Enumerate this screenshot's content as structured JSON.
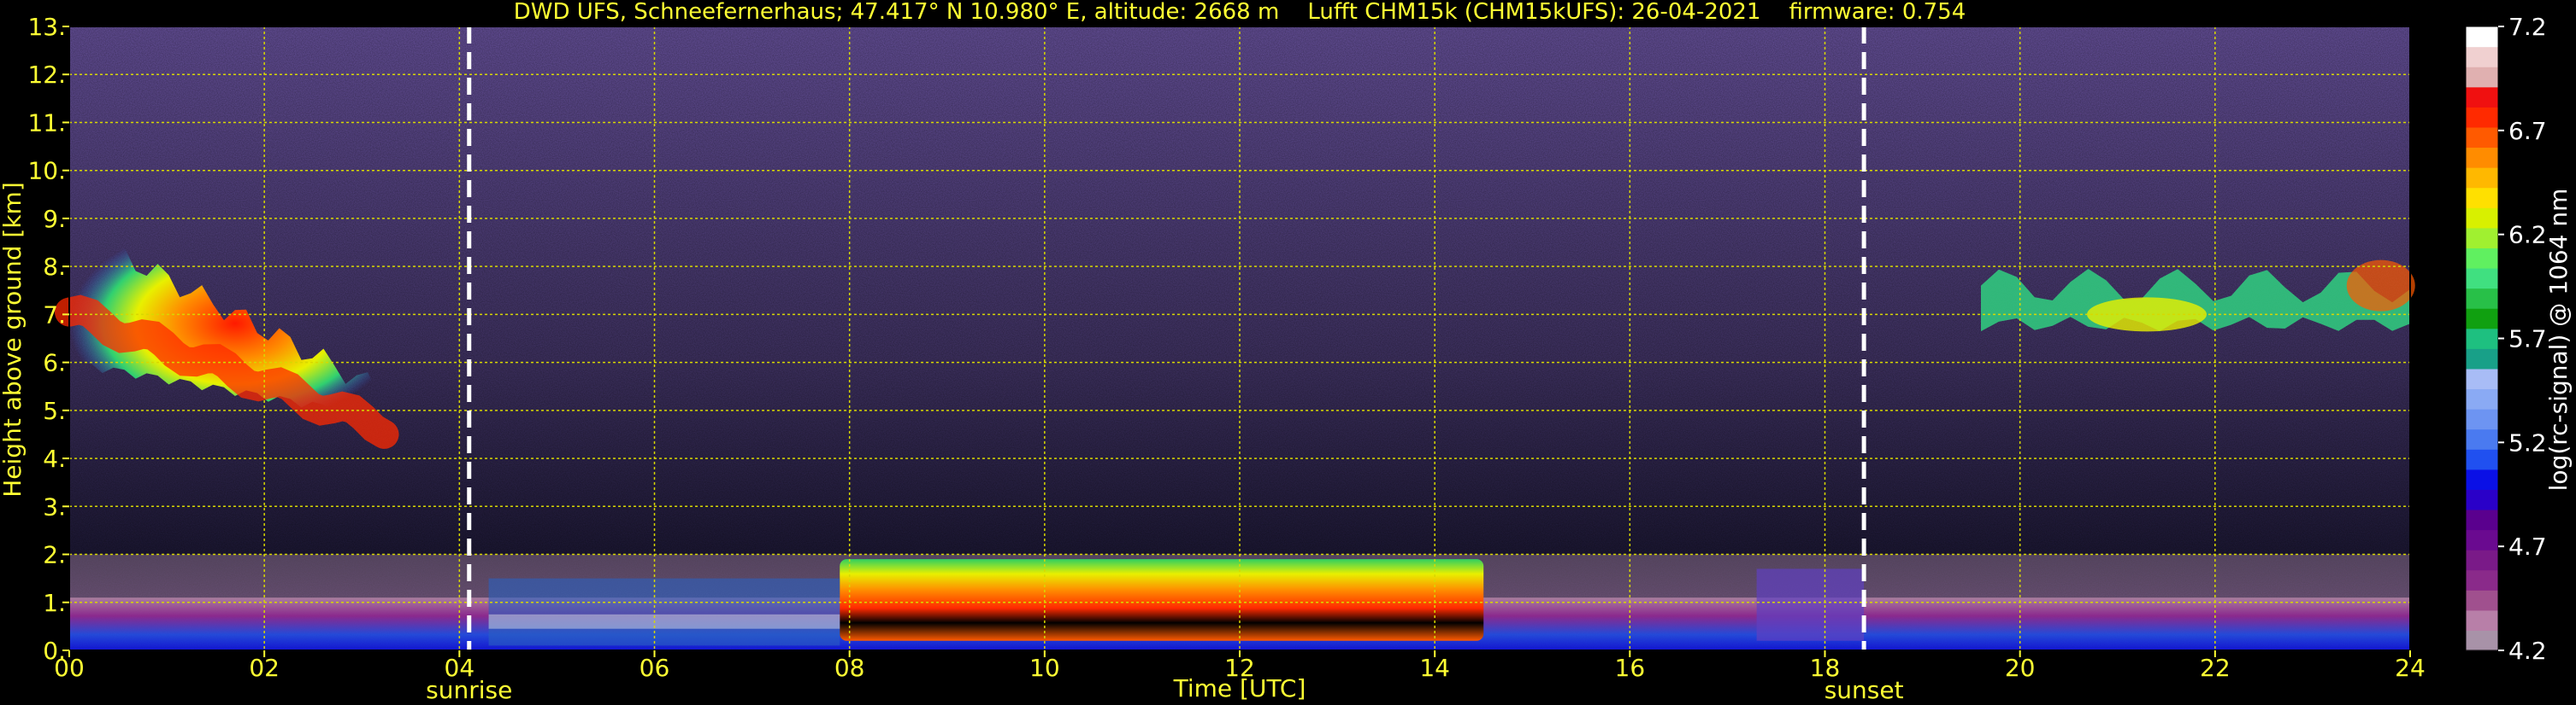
{
  "chart_data": {
    "type": "heatmap",
    "title": "DWD UFS, Schneefernerhaus; 47.417° N 10.980° E, altitude: 2668 m    Lufft CHM15k (CHM15kUFS): 26-04-2021    firmware: 0.754",
    "xlabel": "Time [UTC]",
    "ylabel": "Height above ground [km]",
    "xlim": [
      0,
      24
    ],
    "ylim": [
      0,
      13
    ],
    "x_ticks": [
      "00",
      "02",
      "04",
      "06",
      "08",
      "10",
      "12",
      "14",
      "16",
      "18",
      "20",
      "22",
      "24"
    ],
    "y_ticks": [
      "0.",
      "1.",
      "2.",
      "3.",
      "4.",
      "5.",
      "6.",
      "7.",
      "8.",
      "9.",
      "10.",
      "11.",
      "12.",
      "13."
    ],
    "grid": true,
    "annotations": [
      {
        "label": "sunrise",
        "x": 4.1
      },
      {
        "label": "sunset",
        "x": 18.4
      }
    ],
    "colorbar": {
      "label": "log(rc-signal) @ 1064 nm",
      "range": [
        4.2,
        7.2
      ],
      "ticks": [
        "4.2",
        "4.7",
        "5.2",
        "5.7",
        "6.2",
        "6.7",
        "7.2"
      ],
      "colors": [
        "#a892a8",
        "#b87fa8",
        "#a0508e",
        "#8a2a8a",
        "#7a1a88",
        "#6a0a90",
        "#5a008e",
        "#2a00c8",
        "#0a10e6",
        "#2050f0",
        "#4a7af0",
        "#6d94f2",
        "#8aaaf4",
        "#a8bcf6",
        "#18a088",
        "#1ec080",
        "#10a010",
        "#28c048",
        "#40e080",
        "#60f060",
        "#a0f030",
        "#d8f000",
        "#ffe000",
        "#ffb800",
        "#ff8c00",
        "#ff5a00",
        "#ff2a00",
        "#f01010",
        "#e0b0b0",
        "#f0d0d0",
        "#ffffff"
      ]
    },
    "features": [
      {
        "name": "cloud layer",
        "x": [
          0,
          3.4
        ],
        "y_top": [
          8.4,
          4.8
        ],
        "y_base": [
          6.0,
          4.8
        ],
        "peak": 6.7
      },
      {
        "name": "boundary layer",
        "x": [
          7.9,
          14.5
        ],
        "y": [
          0.2,
          1.9
        ],
        "peak": 6.9
      },
      {
        "name": "cloud layer",
        "x": [
          19.6,
          24
        ],
        "y": [
          6.5,
          8.3
        ],
        "peak": 6.5
      }
    ]
  }
}
